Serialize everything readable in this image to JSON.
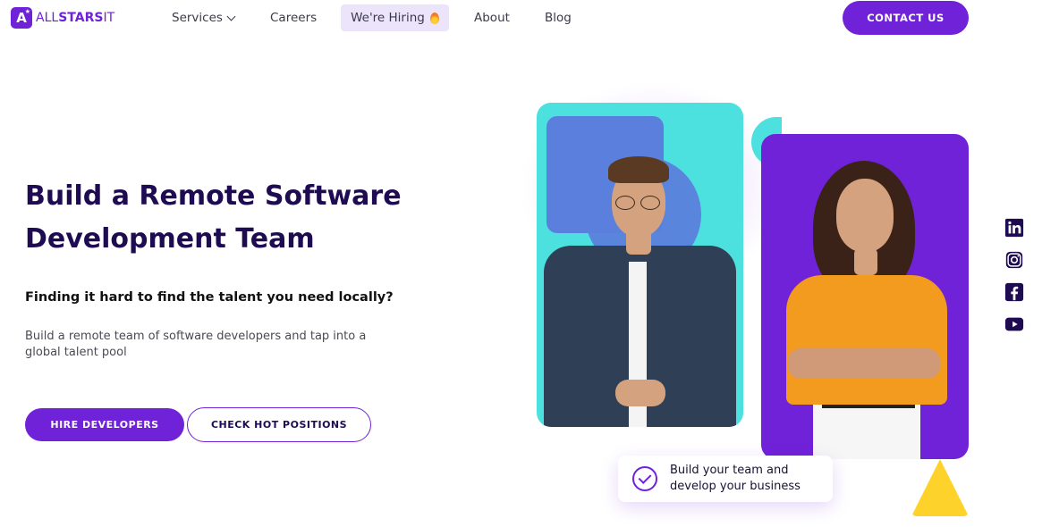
{
  "brand": {
    "logo_letter": "A",
    "name_light": "ALL",
    "name_bold": "STARS",
    "name_suffix": "IT"
  },
  "nav": {
    "items": [
      {
        "label": "Services"
      },
      {
        "label": "Careers"
      },
      {
        "label": "We're Hiring"
      },
      {
        "label": "About"
      },
      {
        "label": "Blog"
      }
    ],
    "contact_label": "CONTACT US"
  },
  "hero": {
    "title_line1": "Build a Remote Software",
    "title_line2": "Development Team",
    "subtitle": "Finding it hard to find the talent you need locally?",
    "description": "Build a remote team of software developers and tap into a global talent pool",
    "primary_button": "HIRE DEVELOPERS",
    "secondary_button": "CHECK HOT POSITIONS"
  },
  "badge": {
    "line1": "Build your team and",
    "line2": "develop your business"
  },
  "social": [
    "linkedin-icon",
    "instagram-icon",
    "facebook-icon",
    "youtube-icon"
  ],
  "colors": {
    "brand": "#7022d8",
    "cyan": "#4ce0de",
    "navy": "#1f0b52",
    "yellow": "#fdd22a",
    "blue": "#5b7fdc"
  }
}
